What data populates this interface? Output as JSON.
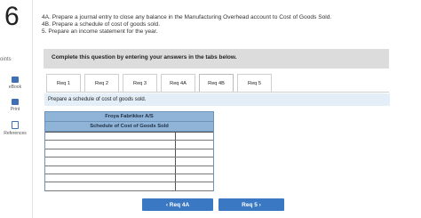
{
  "question": {
    "number": "6",
    "points_label": "oints"
  },
  "sidebar": {
    "items": [
      {
        "label": "eBook",
        "icon": "book-icon",
        "color": "#3f6fb5"
      },
      {
        "label": "Print",
        "icon": "printer-icon",
        "color": "#3f6fb5"
      },
      {
        "label": "References",
        "icon": "references-icon",
        "color": "#3f6fb5"
      }
    ]
  },
  "instructions": [
    "4A. Prepare a journal entry to close any balance in the Manufacturing Overhead account to Cost of Goods Sold.",
    "4B. Prepare a schedule of cost of goods sold.",
    "5. Prepare an income statement for the year."
  ],
  "banner": {
    "text": "Complete this question by entering your answers in the tabs below."
  },
  "tabs": [
    {
      "label": "Req 1"
    },
    {
      "label": "Req 2"
    },
    {
      "label": "Req 3"
    },
    {
      "label": "Req 4A"
    },
    {
      "label": "Req 4B",
      "active": true
    },
    {
      "label": "Req 5"
    }
  ],
  "prompt": "Prepare a schedule of cost of goods sold.",
  "schedule": {
    "company": "Froya Fabrikker A/S",
    "title": "Schedule of Cost of Goods Sold",
    "rows": [
      [
        "",
        ""
      ],
      [
        "",
        ""
      ],
      [
        "",
        ""
      ],
      [
        "",
        ""
      ],
      [
        "",
        ""
      ],
      [
        "",
        ""
      ],
      [
        "",
        ""
      ]
    ]
  },
  "nav": {
    "prev_label": "‹  Req 4A",
    "next_label": "Req 5  ›",
    "color": "#3a78c3"
  }
}
